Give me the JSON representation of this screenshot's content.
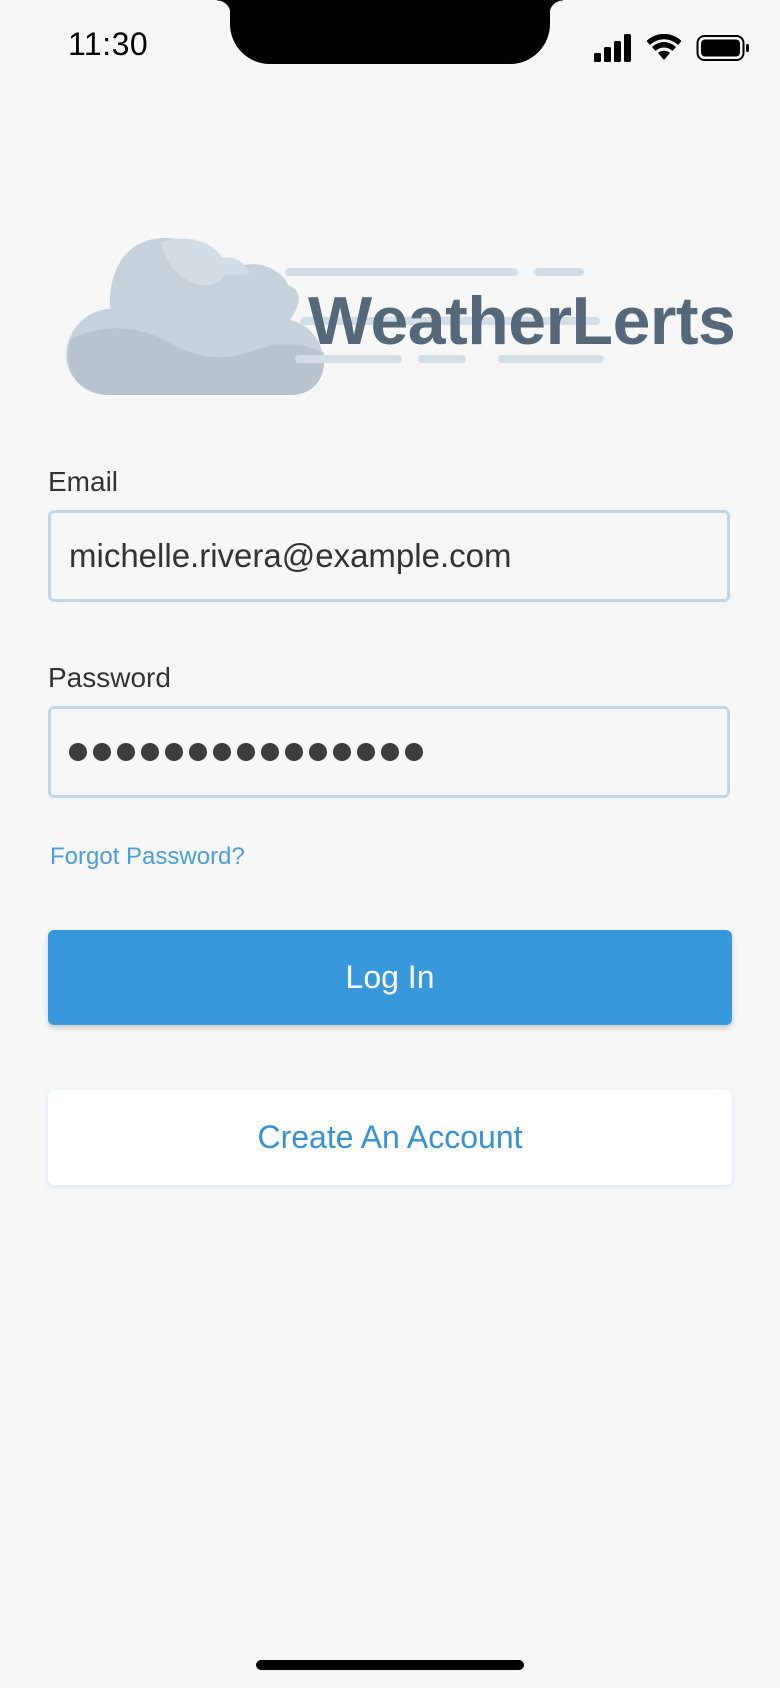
{
  "status_bar": {
    "time": "11:30",
    "icons": [
      "cellular-signal-icon",
      "wifi-icon",
      "battery-icon"
    ]
  },
  "logo": {
    "text": "WeatherLerts",
    "icon": "cloud-icon"
  },
  "form": {
    "email_label": "Email",
    "email_value": "michelle.rivera@example.com",
    "password_label": "Password",
    "password_mask_count": 15,
    "forgot_link": "Forgot Password?",
    "login_button": "Log In",
    "create_button": "Create An Account"
  },
  "colors": {
    "background": "#f7f7f7",
    "accent": "#3798dc",
    "logo_text": "#55687a",
    "field_border": "#c2d7e6",
    "link": "#4a9fd8"
  }
}
